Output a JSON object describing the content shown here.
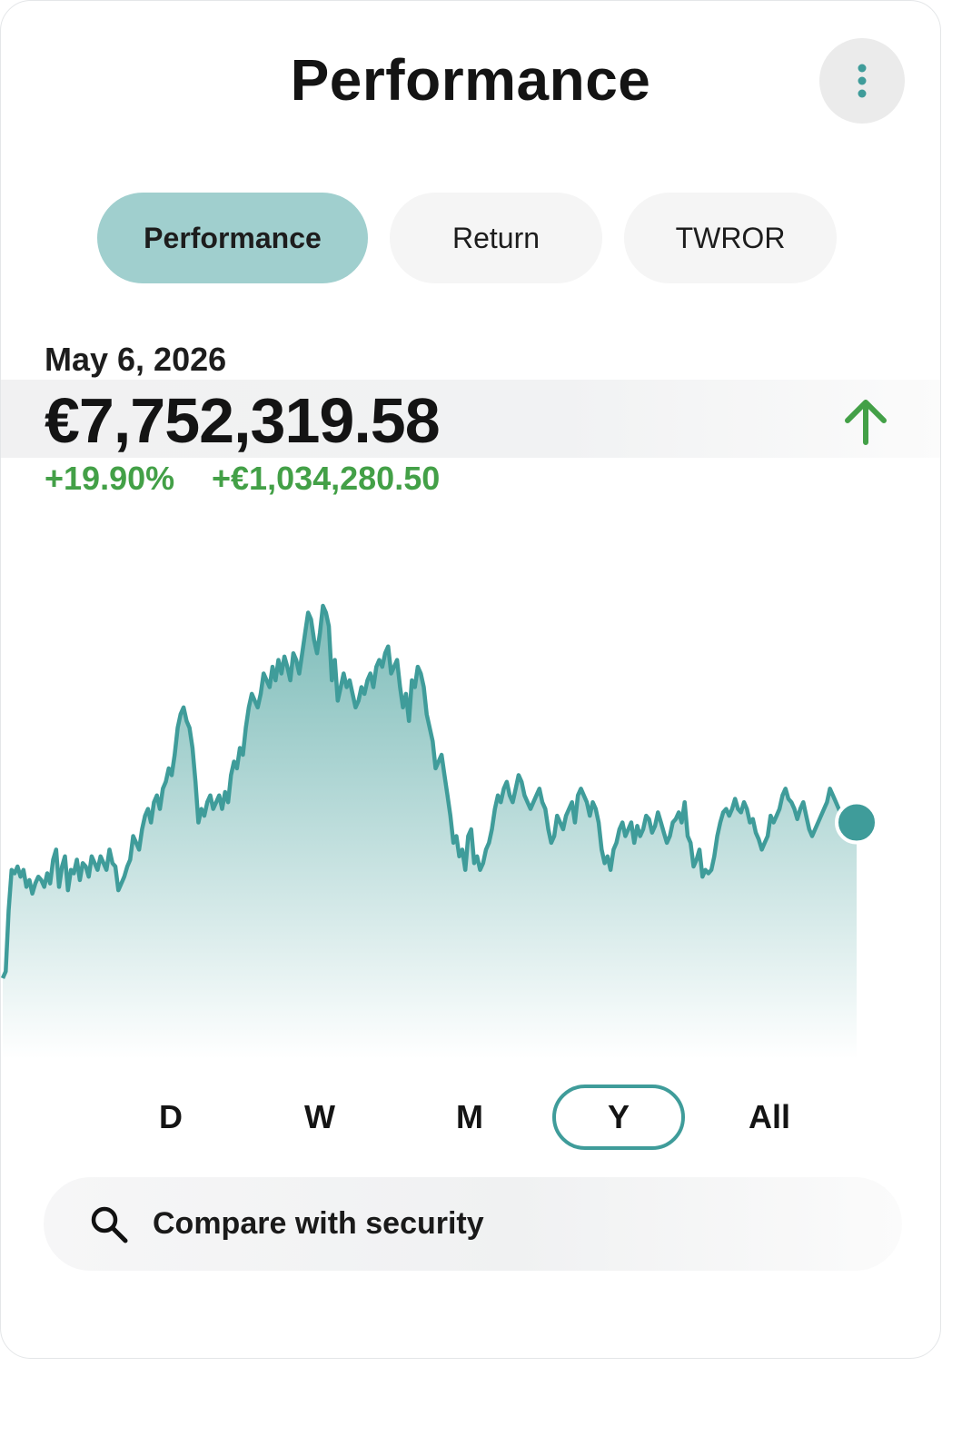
{
  "header": {
    "title": "Performance",
    "more_icon": "more-vertical-icon"
  },
  "tabs": [
    {
      "label": "Performance",
      "active": true
    },
    {
      "label": "Return",
      "active": false
    },
    {
      "label": "TWROR",
      "active": false
    }
  ],
  "summary": {
    "date": "May 6, 2026",
    "value": "€7,752,319.58",
    "change_percent": "+19.90%",
    "change_amount": "+€1,034,280.50",
    "trend_icon": "arrow-up-icon",
    "positive_color": "#43a047"
  },
  "chart_data": {
    "type": "area",
    "title": "",
    "xlabel": "",
    "ylabel": "",
    "grid": false,
    "color": "#3f9c9a",
    "values": [
      6.7,
      6.72,
      6.9,
      7.02,
      7.01,
      7.03,
      7.0,
      7.02,
      6.97,
      6.99,
      6.95,
      6.98,
      7.0,
      6.99,
      6.97,
      7.01,
      6.98,
      7.05,
      7.08,
      6.97,
      7.03,
      7.06,
      6.96,
      7.02,
      7.01,
      7.05,
      6.99,
      7.04,
      7.03,
      7.0,
      7.06,
      7.04,
      7.02,
      7.06,
      7.04,
      7.02,
      7.08,
      7.04,
      7.03,
      6.96,
      6.98,
      7.0,
      7.03,
      7.05,
      7.12,
      7.1,
      7.08,
      7.14,
      7.18,
      7.2,
      7.16,
      7.22,
      7.24,
      7.2,
      7.26,
      7.28,
      7.32,
      7.3,
      7.36,
      7.44,
      7.48,
      7.5,
      7.46,
      7.44,
      7.38,
      7.28,
      7.16,
      7.2,
      7.18,
      7.22,
      7.24,
      7.2,
      7.22,
      7.24,
      7.2,
      7.25,
      7.22,
      7.3,
      7.34,
      7.32,
      7.38,
      7.36,
      7.44,
      7.5,
      7.54,
      7.52,
      7.5,
      7.54,
      7.6,
      7.58,
      7.56,
      7.62,
      7.58,
      7.64,
      7.6,
      7.65,
      7.62,
      7.58,
      7.66,
      7.64,
      7.6,
      7.66,
      7.72,
      7.78,
      7.76,
      7.7,
      7.66,
      7.72,
      7.8,
      7.78,
      7.74,
      7.58,
      7.64,
      7.52,
      7.56,
      7.6,
      7.56,
      7.58,
      7.54,
      7.5,
      7.52,
      7.56,
      7.54,
      7.58,
      7.6,
      7.56,
      7.62,
      7.64,
      7.62,
      7.66,
      7.68,
      7.6,
      7.62,
      7.64,
      7.56,
      7.5,
      7.54,
      7.46,
      7.58,
      7.56,
      7.62,
      7.6,
      7.56,
      7.48,
      7.44,
      7.4,
      7.32,
      7.34,
      7.36,
      7.3,
      7.24,
      7.18,
      7.1,
      7.12,
      7.06,
      7.08,
      7.02,
      7.12,
      7.14,
      7.04,
      7.06,
      7.02,
      7.04,
      7.08,
      7.1,
      7.14,
      7.2,
      7.24,
      7.22,
      7.26,
      7.28,
      7.24,
      7.22,
      7.26,
      7.3,
      7.28,
      7.24,
      7.22,
      7.2,
      7.22,
      7.24,
      7.26,
      7.22,
      7.2,
      7.14,
      7.1,
      7.12,
      7.18,
      7.16,
      7.14,
      7.18,
      7.2,
      7.22,
      7.16,
      7.24,
      7.26,
      7.24,
      7.22,
      7.18,
      7.22,
      7.2,
      7.16,
      7.08,
      7.04,
      7.06,
      7.02,
      7.08,
      7.1,
      7.14,
      7.16,
      7.12,
      7.14,
      7.16,
      7.1,
      7.15,
      7.12,
      7.14,
      7.18,
      7.17,
      7.13,
      7.15,
      7.19,
      7.16,
      7.13,
      7.1,
      7.12,
      7.16,
      7.17,
      7.19,
      7.16,
      7.22,
      7.12,
      7.1,
      7.03,
      7.05,
      7.08,
      7.0,
      7.02,
      7.01,
      7.02,
      7.06,
      7.12,
      7.16,
      7.19,
      7.2,
      7.18,
      7.2,
      7.23,
      7.2,
      7.19,
      7.22,
      7.2,
      7.16,
      7.17,
      7.13,
      7.11,
      7.08,
      7.1,
      7.12,
      7.18,
      7.16,
      7.18,
      7.2,
      7.24,
      7.26,
      7.23,
      7.22,
      7.2,
      7.17,
      7.2,
      7.22,
      7.18,
      7.14,
      7.12,
      7.14,
      7.16,
      7.18,
      7.2,
      7.22,
      7.26,
      7.24,
      7.22,
      7.2,
      7.18,
      7.2,
      7.16,
      7.18,
      7.2,
      7.16
    ],
    "last_point_marker": true
  },
  "ranges": [
    {
      "label": "D",
      "active": false
    },
    {
      "label": "W",
      "active": false
    },
    {
      "label": "M",
      "active": false
    },
    {
      "label": "Y",
      "active": true
    },
    {
      "label": "All",
      "active": false
    }
  ],
  "compare": {
    "label": "Compare with security",
    "icon": "search-icon"
  }
}
